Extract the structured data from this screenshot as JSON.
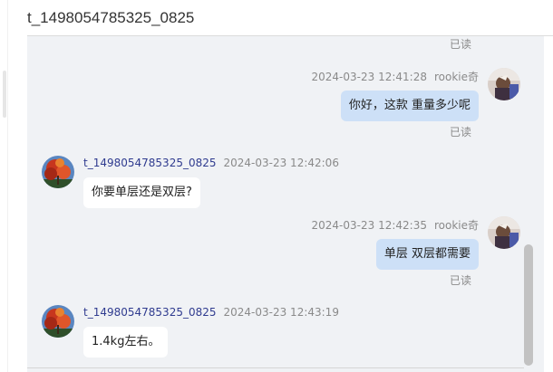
{
  "header": {
    "title": "t_1498054785325_0825"
  },
  "messages": [
    {
      "side": "read-only",
      "read_status": "已读"
    },
    {
      "side": "right",
      "timestamp": "2024-03-23 12:41:28",
      "sender": "rookie奇",
      "text": "你好，这款 重量多少呢",
      "read_status": "已读"
    },
    {
      "side": "left",
      "sender": "t_1498054785325_0825",
      "timestamp": "2024-03-23 12:42:06",
      "text": "你要单层还是双层?"
    },
    {
      "side": "right",
      "timestamp": "2024-03-23 12:42:35",
      "sender": "rookie奇",
      "text": "单层 双层都需要",
      "read_status": "已读"
    },
    {
      "side": "left",
      "sender": "t_1498054785325_0825",
      "timestamp": "2024-03-23 12:43:19",
      "text": "1.4kg左右。"
    }
  ],
  "colors": {
    "chat_background": "#f0f2f5",
    "my_bubble": "#cde0f7",
    "their_bubble": "#ffffff",
    "sender_name_left": "#2f3b8f",
    "meta_text": "#8a8a8a"
  },
  "icons": {
    "my_avatar": "user-avatar-icon",
    "their_avatar": "shop-avatar-icon"
  }
}
